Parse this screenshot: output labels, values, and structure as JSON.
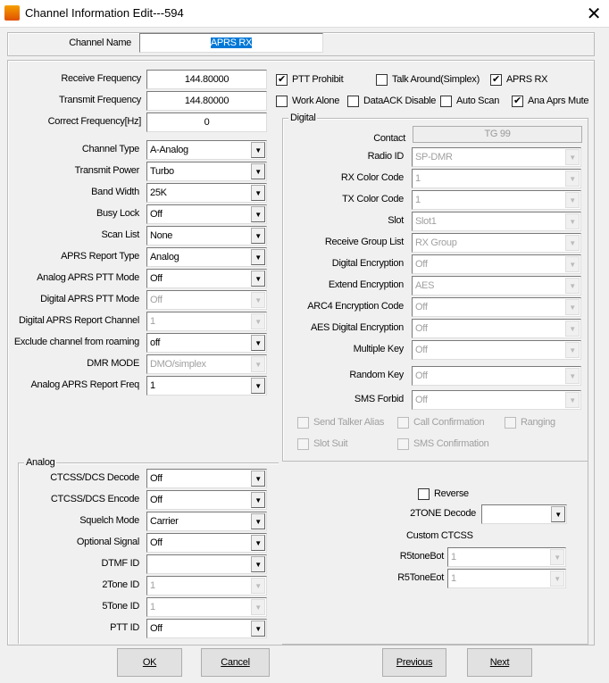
{
  "window": {
    "title": "Channel Information Edit---594",
    "close": "✕"
  },
  "channel_name": {
    "label": "Channel Name",
    "value": "APRS RX"
  },
  "frequencies": [
    {
      "label": "Receive Frequency",
      "value": "144.80000"
    },
    {
      "label": "Transmit Frequency",
      "value": "144.80000"
    },
    {
      "label": "Correct Frequency[Hz]",
      "value": "0"
    }
  ],
  "options": [
    {
      "label": "PTT Prohibit",
      "checked": true
    },
    {
      "label": "Talk Around(Simplex)",
      "checked": false
    },
    {
      "label": "APRS RX",
      "checked": true
    },
    {
      "label": "Work Alone",
      "checked": false
    },
    {
      "label": "DataACK Disable",
      "checked": false
    },
    {
      "label": "Auto Scan",
      "checked": false
    },
    {
      "label": "Ana Aprs Mute",
      "checked": true
    }
  ],
  "general": [
    {
      "label": "Channel Type",
      "value": "A-Analog",
      "disabled": false
    },
    {
      "label": "Transmit Power",
      "value": "Turbo",
      "disabled": false
    },
    {
      "label": "Band Width",
      "value": "25K",
      "disabled": false
    },
    {
      "label": "Busy Lock",
      "value": "Off",
      "disabled": false
    },
    {
      "label": "Scan List",
      "value": "None",
      "disabled": false
    },
    {
      "label": "APRS Report Type",
      "value": "Analog",
      "disabled": false
    },
    {
      "label": "Analog APRS PTT Mode",
      "value": "Off",
      "disabled": false
    },
    {
      "label": "Digital APRS PTT Mode",
      "value": "Off",
      "disabled": true
    },
    {
      "label": "Digital APRS Report Channel",
      "value": "1",
      "disabled": true
    },
    {
      "label": "Exclude channel from roaming",
      "value": "off",
      "disabled": false
    },
    {
      "label": "DMR MODE",
      "value": "DMO/simplex",
      "disabled": true
    },
    {
      "label": "Analog APRS Report Freq",
      "value": "1",
      "disabled": false
    }
  ],
  "digital": {
    "title": "Digital",
    "contact_label": "Contact",
    "contact_value": "TG 99",
    "fields": [
      {
        "label": "Radio ID",
        "value": "SP-DMR"
      },
      {
        "label": "RX Color Code",
        "value": "1"
      },
      {
        "label": "TX Color Code",
        "value": "1"
      },
      {
        "label": "Slot",
        "value": "Slot1"
      },
      {
        "label": "Receive Group List",
        "value": "RX Group"
      },
      {
        "label": "Digital Encryption",
        "value": "Off"
      },
      {
        "label": "Extend Encryption",
        "value": "AES"
      },
      {
        "label": "ARC4 Encryption Code",
        "value": "Off"
      },
      {
        "label": "AES Digital Encryption",
        "value": "Off"
      },
      {
        "label": "Multiple Key",
        "value": "Off"
      },
      {
        "label": "Random Key",
        "value": "Off"
      },
      {
        "label": "SMS Forbid",
        "value": "Off"
      }
    ],
    "checks": [
      {
        "label": "Send Talker Alias",
        "checked": false
      },
      {
        "label": "Call Confirmation",
        "checked": false
      },
      {
        "label": "Ranging",
        "checked": false
      },
      {
        "label": "Slot Suit",
        "checked": false
      },
      {
        "label": "SMS Confirmation",
        "checked": false
      }
    ]
  },
  "analog": {
    "title": "Analog",
    "fields": [
      {
        "label": "CTCSS/DCS Decode",
        "value": "Off",
        "disabled": false
      },
      {
        "label": "CTCSS/DCS Encode",
        "value": "Off",
        "disabled": false
      },
      {
        "label": "Squelch Mode",
        "value": "Carrier",
        "disabled": false
      },
      {
        "label": "Optional Signal",
        "value": "Off",
        "disabled": false
      },
      {
        "label": "DTMF ID",
        "value": "",
        "disabled": false
      },
      {
        "label": "2Tone ID",
        "value": "1",
        "disabled": true
      },
      {
        "label": "5Tone ID",
        "value": "1",
        "disabled": true
      },
      {
        "label": "PTT ID",
        "value": "Off",
        "disabled": false
      }
    ]
  },
  "extra": {
    "reverse": {
      "label": "Reverse",
      "checked": false
    },
    "twotone_label": "2TONE Decode",
    "twotone_value": "",
    "custom_ctcss": "Custom CTCSS",
    "r5bot_label": "R5toneBot",
    "r5bot_value": "1",
    "r5eot_label": "R5ToneEot",
    "r5eot_value": "1"
  },
  "buttons": {
    "ok": "OK",
    "cancel": "Cancel",
    "previous": "Previous",
    "next": "Next"
  }
}
